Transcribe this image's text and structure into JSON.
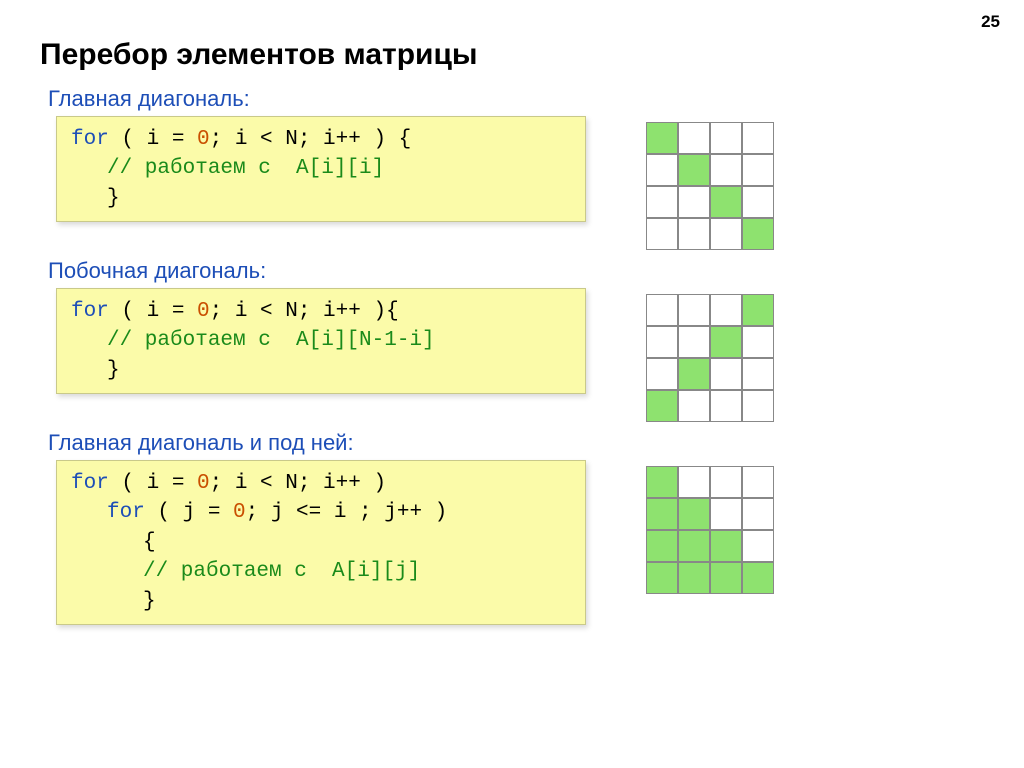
{
  "page_number": "25",
  "title": "Перебор элементов матрицы",
  "sections": [
    {
      "label": "Главная диагональ:",
      "code": [
        [
          {
            "t": "for",
            "c": "kw"
          },
          {
            "t": " ( i = ",
            "c": ""
          },
          {
            "t": "0",
            "c": "num"
          },
          {
            "t": "; i < N; i++ ) {",
            "c": ""
          }
        ],
        [
          {
            "t": "// работаем с  A[i][i]",
            "c": "cm"
          }
        ],
        [
          {
            "t": "}",
            "c": ""
          }
        ]
      ],
      "indent": [
        "",
        "indent1",
        "indent1"
      ],
      "grid": [
        [
          1,
          0,
          0,
          0
        ],
        [
          0,
          1,
          0,
          0
        ],
        [
          0,
          0,
          1,
          0
        ],
        [
          0,
          0,
          0,
          1
        ]
      ]
    },
    {
      "label": "Побочная диагональ:",
      "code": [
        [
          {
            "t": "for",
            "c": "kw"
          },
          {
            "t": " ( i = ",
            "c": ""
          },
          {
            "t": "0",
            "c": "num"
          },
          {
            "t": "; i < N; i++ ){",
            "c": ""
          }
        ],
        [
          {
            "t": "// работаем с  A[i][N-1-i]",
            "c": "cm"
          }
        ],
        [
          {
            "t": "}",
            "c": ""
          }
        ]
      ],
      "indent": [
        "",
        "indent1",
        "indent1"
      ],
      "grid": [
        [
          0,
          0,
          0,
          1
        ],
        [
          0,
          0,
          1,
          0
        ],
        [
          0,
          1,
          0,
          0
        ],
        [
          1,
          0,
          0,
          0
        ]
      ]
    },
    {
      "label": "Главная диагональ и под ней:",
      "code": [
        [
          {
            "t": "for",
            "c": "kw"
          },
          {
            "t": " ( i = ",
            "c": ""
          },
          {
            "t": "0",
            "c": "num"
          },
          {
            "t": "; i < N; i++ )",
            "c": ""
          }
        ],
        [
          {
            "t": "for",
            "c": "kw"
          },
          {
            "t": " ( j = ",
            "c": ""
          },
          {
            "t": "0",
            "c": "num"
          },
          {
            "t": "; j <= i ; j++ )",
            "c": ""
          }
        ],
        [
          {
            "t": "{",
            "c": ""
          }
        ],
        [
          {
            "t": "// работаем с  A[i][j]",
            "c": "cm"
          }
        ],
        [
          {
            "t": "}",
            "c": ""
          }
        ]
      ],
      "indent": [
        "",
        "indent1",
        "indent2",
        "indent2",
        "indent2"
      ],
      "grid": [
        [
          1,
          0,
          0,
          0
        ],
        [
          1,
          1,
          0,
          0
        ],
        [
          1,
          1,
          1,
          0
        ],
        [
          1,
          1,
          1,
          1
        ]
      ]
    }
  ]
}
